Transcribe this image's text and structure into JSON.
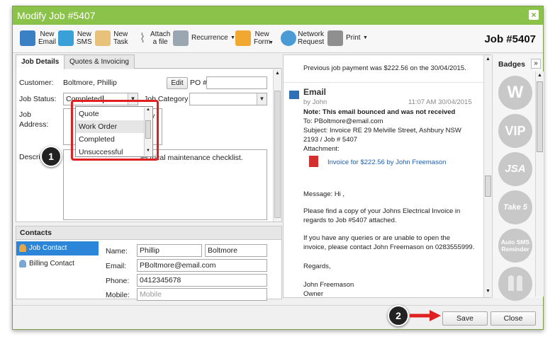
{
  "window": {
    "title": "Modify Job #5407",
    "job_number": "Job #5407"
  },
  "toolbar": [
    {
      "label": "New\nEmail",
      "icon": "email-icon"
    },
    {
      "label": "New\nSMS",
      "icon": "sms-icon"
    },
    {
      "label": "New\nTask",
      "icon": "task-icon"
    },
    {
      "label": "Attach\na file",
      "icon": "paperclip-icon"
    },
    {
      "label": "Recurrence",
      "icon": "recurrence-icon"
    },
    {
      "label": "New\nForm",
      "icon": "form-icon"
    },
    {
      "label": "Network\nRequest",
      "icon": "network-icon"
    },
    {
      "label": "Print",
      "icon": "print-icon"
    }
  ],
  "tabs": [
    "Job Details",
    "Quotes & Invoicing"
  ],
  "form": {
    "customer_label": "Customer:",
    "customer_value": "Boltmore, Phillip",
    "edit_label": "Edit",
    "po_label": "PO #",
    "job_status_label": "Job Status:",
    "job_status_value": "Completed",
    "job_category_label": "Job Category",
    "job_address_label": "Job\nAddress:",
    "job_address_value": "bury",
    "description_label": "Descri",
    "description_value": "lectrical maintenance checklist."
  },
  "status_options": [
    "Quote",
    "Work Order",
    "Completed",
    "Unsuccessful"
  ],
  "contacts": {
    "header": "Contacts",
    "items": [
      "Job Contact",
      "Billing Contact"
    ],
    "name_label": "Name:",
    "first_name": "Phillip",
    "last_name": "Boltmore",
    "email_label": "Email:",
    "email": "PBoltmore@email.com",
    "phone_label": "Phone:",
    "phone": "0412345678",
    "mobile_label": "Mobile:",
    "mobile_placeholder": "Mobile"
  },
  "activity": {
    "payment_note": "Previous job payment was $222.56 on the 30/04/2015.",
    "email_title": "Email",
    "email_by": "by John",
    "email_time": "11:07 AM 30/04/2015",
    "note": "Note: This email bounced and was not received",
    "to": "To: PBoltmore@email.com",
    "subject_1": "Subject: Invoice RE 29 Melville Street, Ashbury NSW",
    "subject_2": "2193 / Job # 5407",
    "attachment_label": "Attachment:",
    "attachment_link": "Invoice for $222.56 by John Freemason",
    "message_1": "Message: Hi ,",
    "message_2": "Please find a copy of your Johns Electrical Invoice in",
    "message_3": "regards to Job #5407 attached.",
    "message_4": "If you have any queries or are unable to open the",
    "message_5": "invoice, please contact John Freemason on 0283555999.",
    "message_6": "Regards,",
    "message_7": "John Freemason",
    "message_8": "Owner"
  },
  "badges": {
    "title": "Badges",
    "expand": "»",
    "items": [
      "W",
      "VIP",
      "JSA",
      "Take 5",
      "Auto SMS\nReminder",
      ""
    ]
  },
  "footer": {
    "save": "Save",
    "close": "Close"
  },
  "callouts": [
    "1",
    "2"
  ],
  "colors": {
    "title_bar": "#8bc34a",
    "highlight": "#e02020",
    "link": "#1a5fb4",
    "selected": "#2b86d9"
  }
}
